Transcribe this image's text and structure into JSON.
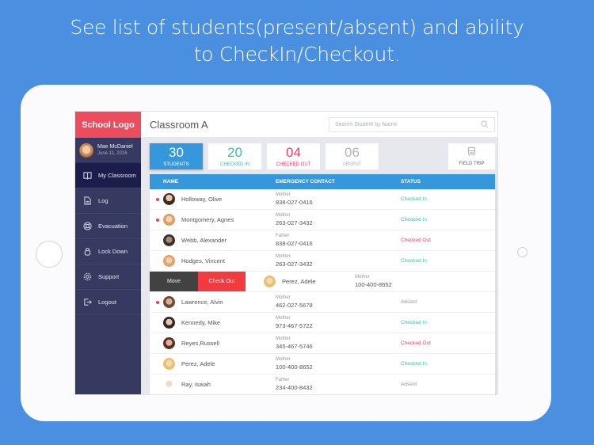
{
  "headline": {
    "line1": "See list of students(present/absent) and ability",
    "line2": "to CheckIn/Checkout."
  },
  "sidebar": {
    "logo": "School Logo",
    "user": {
      "name": "Mae McDaniel",
      "date": "June 11, 2016"
    },
    "items": [
      {
        "label": "My Classroom",
        "icon": "book-icon",
        "active": true
      },
      {
        "label": "Log",
        "icon": "document-icon"
      },
      {
        "label": "Evacuation",
        "icon": "lifebuoy-icon"
      },
      {
        "label": "Lock Down",
        "icon": "lock-icon"
      },
      {
        "label": "Support",
        "icon": "gear-icon"
      },
      {
        "label": "Logout",
        "icon": "logout-icon"
      }
    ]
  },
  "header": {
    "title": "Classroom A",
    "search_placeholder": "Search Student by Name"
  },
  "stats": {
    "total": {
      "value": "30",
      "label": "STUDENTS"
    },
    "checked_in": {
      "value": "20",
      "label": "CHECKED IN"
    },
    "checked_out": {
      "value": "04",
      "label": "CHECKED OUT"
    },
    "absent": {
      "value": "06",
      "label": "ABSENT"
    },
    "field_trip": {
      "label": "FIELD TRIP"
    }
  },
  "table": {
    "columns": [
      "NAME",
      "EMERGENCY CONTACT",
      "STATUS"
    ],
    "rows": [
      {
        "name": "Holloway, Olive",
        "relation": "Mother",
        "phone": "838-027-0416",
        "status": "Checked In",
        "flag": true
      },
      {
        "name": "Montgomery, Agnes",
        "relation": "Mother",
        "phone": "263-027-3432",
        "status": "Checked In",
        "flag": true
      },
      {
        "name": "Webb, Alexander",
        "relation": "Father",
        "phone": "838-027-0416",
        "status": "Checked Out",
        "flag": false
      },
      {
        "name": "Hodges, Vincent",
        "relation": "Mother",
        "phone": "263-027-3432",
        "status": "Checked In",
        "flag": false
      },
      {
        "name": "Perez, Adele",
        "relation": "Mother",
        "phone": "100-400-8652",
        "status": "",
        "flag": false,
        "swiped": true
      },
      {
        "name": "Lawrence, Alvin",
        "relation": "Mother",
        "phone": "462-027-5678",
        "status": "Absent",
        "flag": true
      },
      {
        "name": "Kennedy, Mike",
        "relation": "Mother",
        "phone": "973-467-5722",
        "status": "Checked In",
        "flag": false
      },
      {
        "name": "Reyes,Russell",
        "relation": "Mother",
        "phone": "345-467-5746",
        "status": "Checked Out",
        "flag": false
      },
      {
        "name": "Perez, Adele",
        "relation": "Mother",
        "phone": "100-400-8652",
        "status": "Checked In",
        "flag": false
      },
      {
        "name": "Ray, Isaiah",
        "relation": "Father",
        "phone": "234-400-8432",
        "status": "Absent",
        "flag": false
      }
    ],
    "swipe_actions": {
      "move": "Move",
      "check_out": "Check Out"
    }
  },
  "colors": {
    "background": "#4a8fe0",
    "brand_red": "#ed4c5c",
    "sidebar": "#363a61",
    "accent_blue": "#3697dc",
    "checked_in": "#37c3a3",
    "checked_out": "#ea3f66",
    "absent": "#999999"
  }
}
